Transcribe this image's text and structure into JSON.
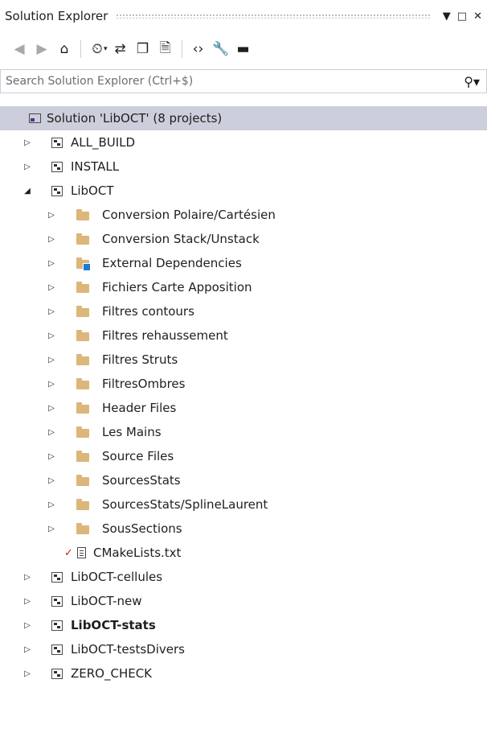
{
  "window": {
    "title": "Solution Explorer",
    "controls": [
      "▼",
      "□",
      "✕"
    ]
  },
  "toolbar": {
    "buttons": [
      {
        "icon": "back-icon",
        "glyph": "◀",
        "disabled": true
      },
      {
        "icon": "forward-icon",
        "glyph": "▶",
        "disabled": true
      },
      {
        "icon": "home-icon",
        "glyph": "⌂",
        "disabled": false
      },
      {
        "icon": "pending-changes-filter-icon",
        "glyph": "⏲",
        "disabled": false
      },
      {
        "icon": "sync-icon",
        "glyph": "⇄",
        "disabled": false
      },
      {
        "icon": "collapse-all-icon",
        "glyph": "❐",
        "disabled": false
      },
      {
        "icon": "show-all-files-icon",
        "glyph": "🗎",
        "disabled": false
      },
      {
        "icon": "view-code-icon",
        "glyph": "‹›",
        "disabled": false
      },
      {
        "icon": "properties-icon",
        "glyph": "🔧",
        "disabled": false
      },
      {
        "icon": "preview-icon",
        "glyph": "▬",
        "disabled": false
      }
    ]
  },
  "search": {
    "placeholder": "Search Solution Explorer (Ctrl+$)",
    "value": "",
    "icon": "search-icon"
  },
  "colors": {
    "selection": "#cccedb",
    "folder": "#dcb67a",
    "accent": "#1e7ad6",
    "git_modified": "#d11a1a"
  },
  "tree": {
    "solution": {
      "label": "Solution 'LibOCT' (8 projects)"
    },
    "projects_before": [
      {
        "label": "ALL_BUILD"
      },
      {
        "label": "INSTALL"
      }
    ],
    "libopt": {
      "label": "LibOCT",
      "folders": [
        {
          "label": "Conversion Polaire/Cartésien"
        },
        {
          "label": "Conversion Stack/Unstack"
        },
        {
          "label": "External Dependencies",
          "external": true
        },
        {
          "label": "Fichiers Carte Apposition"
        },
        {
          "label": "Filtres contours"
        },
        {
          "label": "Filtres rehaussement"
        },
        {
          "label": "Filtres Struts"
        },
        {
          "label": "FiltresOmbres"
        },
        {
          "label": "Header Files"
        },
        {
          "label": "Les Mains"
        },
        {
          "label": "Source Files"
        },
        {
          "label": "SourcesStats"
        },
        {
          "label": "SourcesStats/SplineLaurent"
        },
        {
          "label": "SousSections"
        }
      ],
      "file": {
        "label": "CMakeLists.txt",
        "status_glyph": "✓"
      }
    },
    "projects_after": [
      {
        "label": "LibOCT-cellules",
        "bold": false
      },
      {
        "label": "LibOCT-new",
        "bold": false
      },
      {
        "label": "LibOCT-stats",
        "bold": true
      },
      {
        "label": "LibOCT-testsDivers",
        "bold": false
      },
      {
        "label": "ZERO_CHECK",
        "bold": false
      }
    ]
  }
}
